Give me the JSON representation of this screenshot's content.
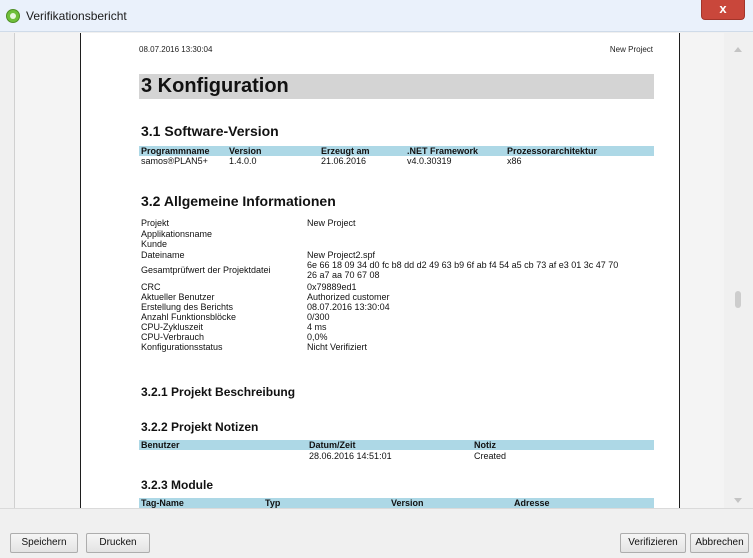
{
  "window": {
    "title": "Verifikationsbericht",
    "close_glyph": "x",
    "icon": "app-shield-icon",
    "close_color": "#c9473b"
  },
  "page_header": {
    "date": "08.07.2016 13:30:04",
    "project": "New Project"
  },
  "section3": {
    "title": "3 Konfiguration"
  },
  "software": {
    "title": "3.1 Software-Version",
    "headers": [
      "Programmname",
      "Version",
      "Erzeugt am",
      ".NET Framework",
      "Prozessorarchitektur"
    ],
    "row": [
      "samos®PLAN5+",
      "1.4.0.0",
      "21.06.2016",
      "v4.0.30319",
      "x86"
    ]
  },
  "info": {
    "title": "3.2 Allgemeine Informationen",
    "rows": [
      {
        "label": "Projekt",
        "value": "New Project"
      },
      {
        "label": "Applikationsname",
        "value": ""
      },
      {
        "label": "Kunde",
        "value": ""
      },
      {
        "label": "Dateiname",
        "value": "New Project2.spf"
      },
      {
        "label": "Gesamtprüfwert der Projektdatei",
        "value": "6e 66 18 09 34 d0 fc b8 dd d2 49 63 b9 6f ab f4 54 a5 cb 73 af e3 01 3c 47 70",
        "value2": "26 a7 aa 70 67 08"
      },
      {
        "label": "CRC",
        "value": "0x79889ed1"
      },
      {
        "label": "Aktueller Benutzer",
        "value": "Authorized customer"
      },
      {
        "label": "Erstellung des Berichts",
        "value": "08.07.2016 13:30:04"
      },
      {
        "label": "Anzahl Funktionsblöcke",
        "value": "0/300"
      },
      {
        "label": "CPU-Zykluszeit",
        "value": "4 ms"
      },
      {
        "label": "CPU-Verbrauch",
        "value": "0,0%"
      },
      {
        "label": "Konfigurationsstatus",
        "value": "Nicht Verifiziert"
      }
    ]
  },
  "beschreibung": {
    "title": "3.2.1 Projekt Beschreibung"
  },
  "notizen": {
    "title": "3.2.2 Projekt Notizen",
    "headers": [
      "Benutzer",
      "Datum/Zeit",
      "Notiz"
    ],
    "row": [
      "",
      "28.06.2016 14:51:01",
      "Created"
    ]
  },
  "module": {
    "title": "3.2.3 Module",
    "headers": [
      "Tag-Name",
      "Typ",
      "Version",
      "Adresse"
    ]
  },
  "colors": {
    "table_header": "#add8e6",
    "heading_bar": "#d4d4d4"
  },
  "buttons": {
    "save": "Speichern",
    "print": "Drucken",
    "verify": "Verifizieren",
    "cancel": "Abbrechen"
  }
}
